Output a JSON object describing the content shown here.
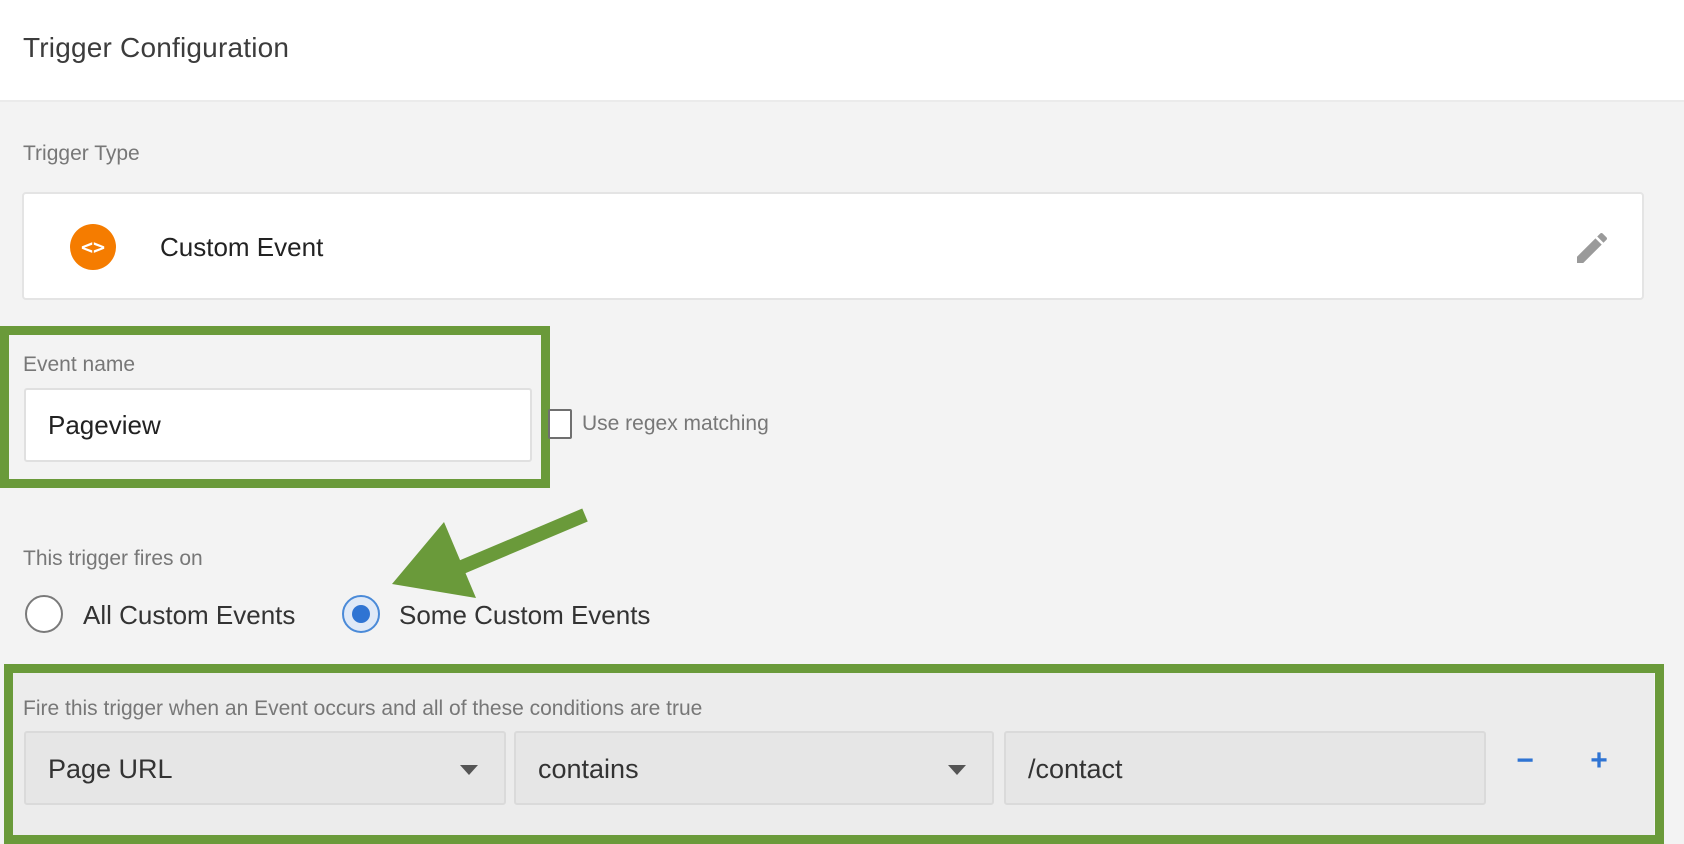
{
  "header": {
    "title": "Trigger Configuration"
  },
  "trigger_type": {
    "label": "Trigger Type",
    "name": "Custom Event",
    "icon": "code-brackets-icon",
    "icon_glyph": "<>",
    "icon_color": "#f57c00"
  },
  "event_name": {
    "label": "Event name",
    "value": "Pageview",
    "regex_label": "Use regex matching",
    "regex_checked": false
  },
  "fires_on": {
    "label": "This trigger fires on",
    "options": [
      {
        "label": "All Custom Events",
        "selected": false
      },
      {
        "label": "Some Custom Events",
        "selected": true
      }
    ]
  },
  "conditions": {
    "label": "Fire this trigger when an Event occurs and all of these conditions are true",
    "rows": [
      {
        "variable": "Page URL",
        "operator": "contains",
        "value": "/contact"
      }
    ],
    "remove_label": "−",
    "add_label": "+"
  },
  "colors": {
    "accent_blue": "#2f74d3",
    "highlight_green": "#6a9a3a",
    "icon_orange": "#f57c00"
  }
}
